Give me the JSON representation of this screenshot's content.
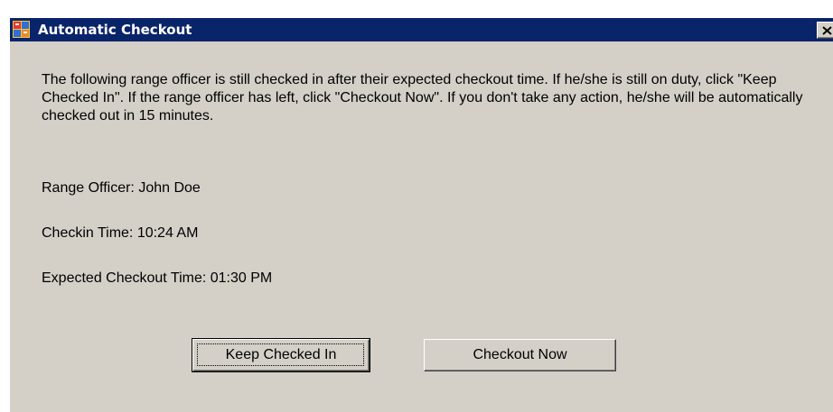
{
  "window": {
    "title": "Automatic Checkout",
    "close_glyph": "×"
  },
  "dialog": {
    "message": "The following range officer is still checked in after their expected checkout time. If he/she is still on duty, click \"Keep Checked In\". If the range officer has left, click \"Checkout Now\". If you don't take any action, he/she will be automatically checked out in 15 minutes.",
    "range_officer": "Range Officer: John Doe",
    "checkin_time": "Checkin Time: 10:24 AM",
    "expected_checkout_time": "Expected Checkout Time: 01:30 PM"
  },
  "buttons": {
    "keep_checked_in": "Keep Checked In",
    "checkout_now": "Checkout Now"
  },
  "colors": {
    "titlebar": "#0a246a",
    "face": "#d4d0c8"
  },
  "icons": {
    "app": "app-icon",
    "close": "close-icon"
  }
}
